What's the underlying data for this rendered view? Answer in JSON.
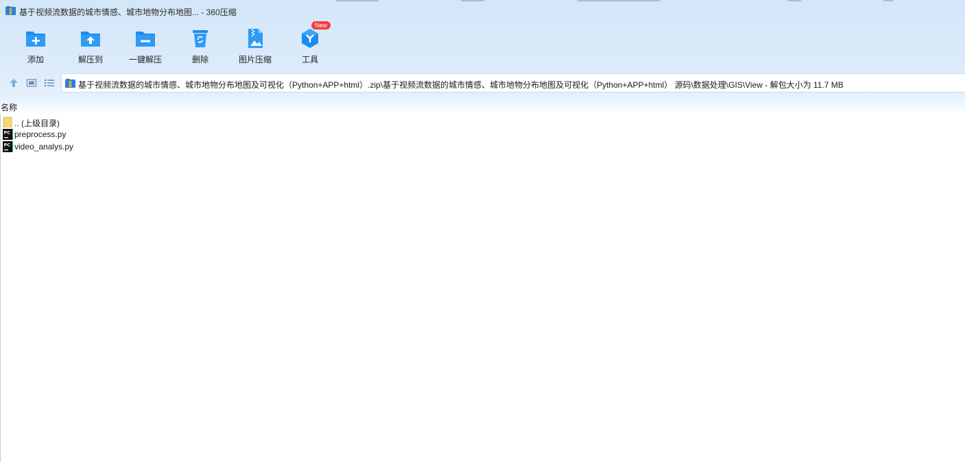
{
  "window": {
    "title": "基于视频流数据的城市情感、城市地物分布地图... - 360压缩"
  },
  "toolbar": {
    "items": [
      {
        "label": "添加",
        "icon": "add-folder-icon"
      },
      {
        "label": "解压到",
        "icon": "extract-to-icon"
      },
      {
        "label": "一键解压",
        "icon": "one-click-extract-icon"
      },
      {
        "label": "删除",
        "icon": "recycle-bin-icon"
      },
      {
        "label": "图片压缩",
        "icon": "image-compress-icon"
      },
      {
        "label": "工具",
        "icon": "tools-cube-icon",
        "badge": "New"
      }
    ]
  },
  "nav": {
    "path": "基于视频流数据的城市情感、城市地物分布地图及可视化（Python+APP+html）.zip\\基于视频流数据的城市情感、城市地物分布地图及可视化（Python+APP+html） 源码\\数据处理\\GIS\\View - 解包大小为 11.7 MB"
  },
  "list": {
    "column_name": "名称",
    "rows": [
      {
        "name": ".. (上级目录)",
        "type": "parent-folder"
      },
      {
        "name": "preprocess.py",
        "type": "pycharm-file"
      },
      {
        "name": "video_analys.py",
        "type": "pycharm-file"
      }
    ]
  },
  "colors": {
    "toolbar_blue": "#1a8cf0",
    "header_bg": "#d3e6f8",
    "badge_red": "#f23c3c",
    "folder_yellow": "#f5d77a"
  }
}
